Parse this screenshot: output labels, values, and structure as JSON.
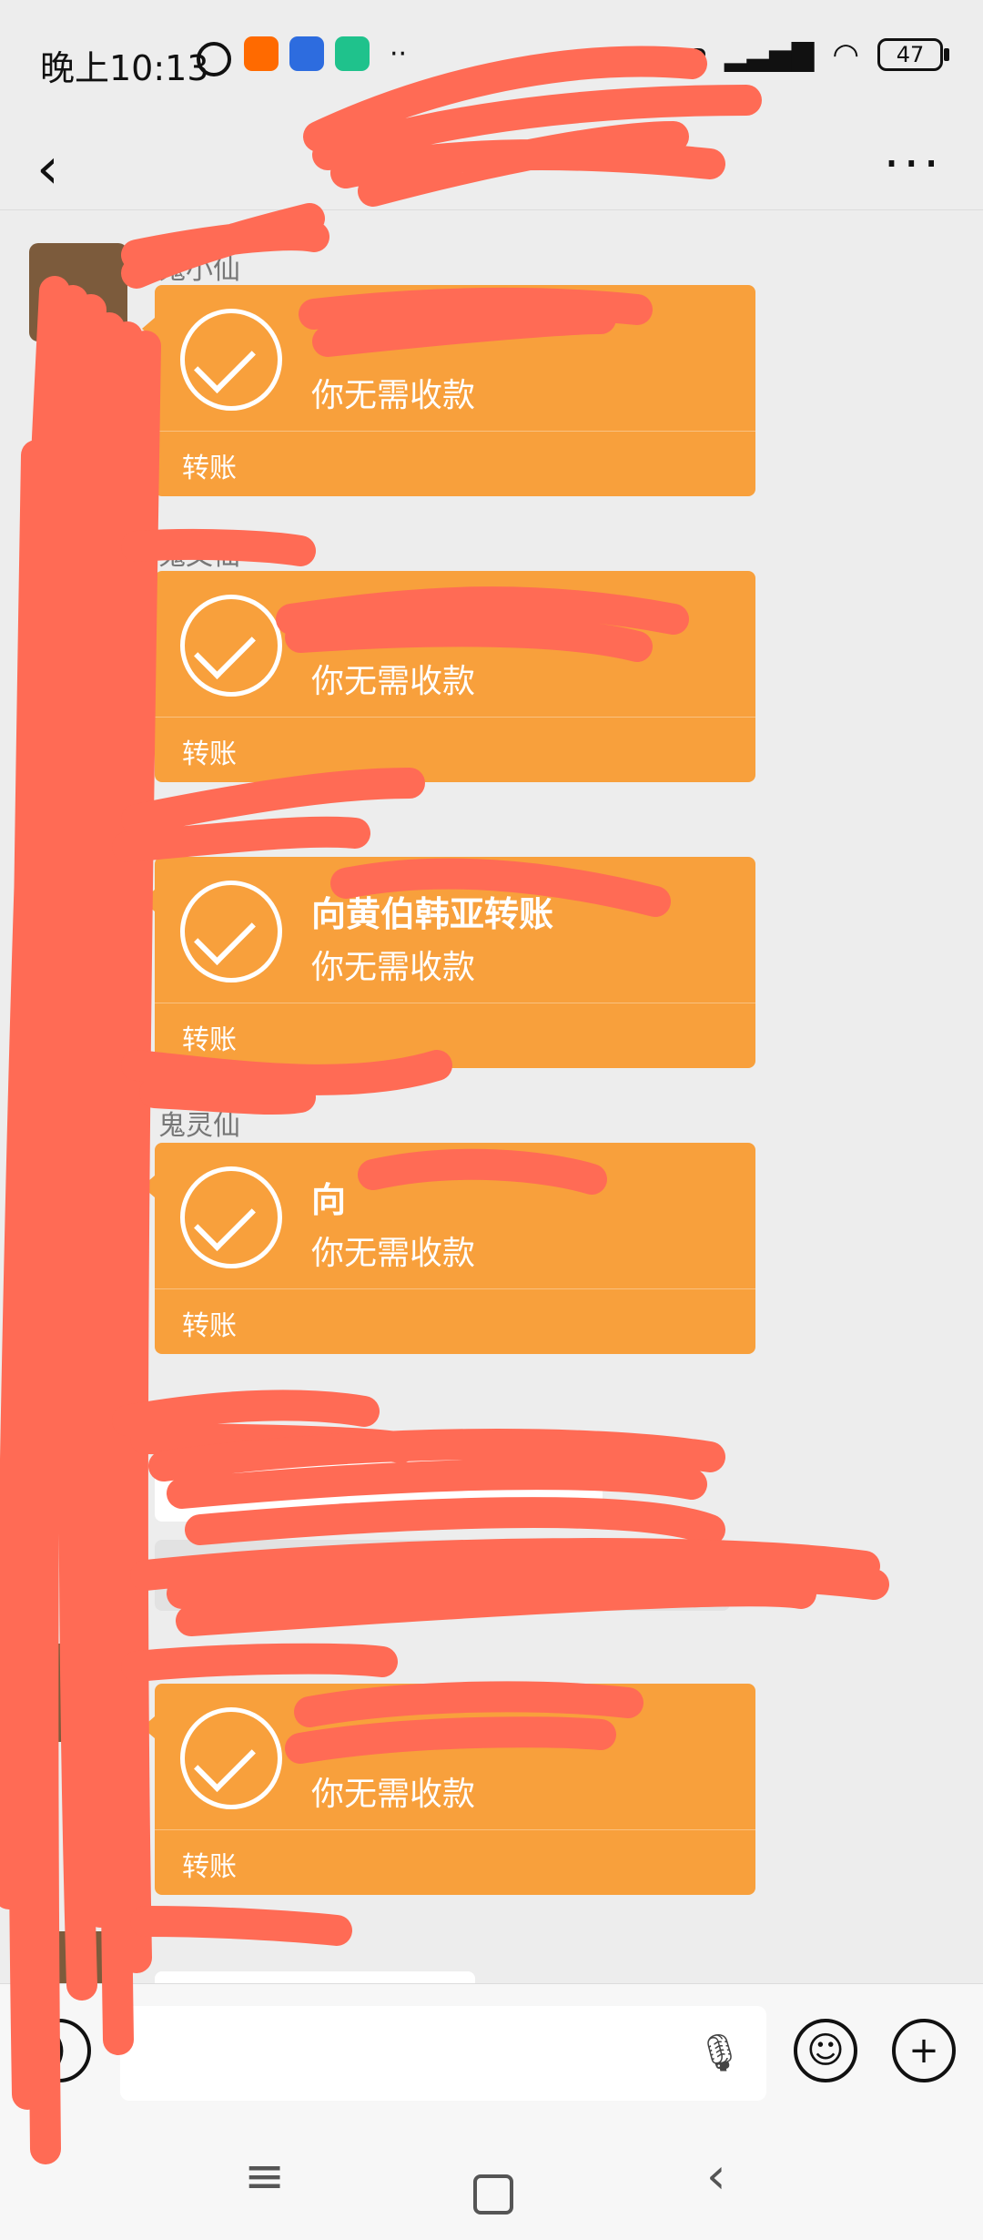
{
  "status_bar": {
    "time": "晚上10:13",
    "alarm_icon": "alarm-icon",
    "network_label": "HD",
    "battery": "47"
  },
  "header": {
    "back_icon": "chevron-left-icon",
    "more_icon": "more-dots-icon"
  },
  "messages": [
    {
      "sender": "鬼小仙",
      "subtitle": "你无需收款",
      "footer": "转账"
    },
    {
      "sender": "鬼文仙",
      "subtitle": "你无需收款",
      "footer": "转账"
    },
    {
      "title": "向黄伯韩亚转账",
      "subtitle": "你无需收款",
      "footer": "转账"
    },
    {
      "sender": "鬼灵仙",
      "title": "向",
      "subtitle": "你无需收款",
      "footer": "转账"
    },
    {
      "subtitle": "你无需收款",
      "footer": "转账"
    }
  ],
  "input_bar": {
    "voice_icon": "voice-toggle-icon",
    "mic_icon": "microphone-icon",
    "emoji_icon": "emoji-icon",
    "plus_icon": "plus-icon"
  },
  "nav_bar": {
    "menu_icon": "menu-icon",
    "home_icon": "home-square-icon",
    "back_icon": "back-triangle-icon"
  },
  "colors": {
    "transfer_card": "#f8a03c",
    "redaction": "#ff6b55",
    "background": "#ededed"
  }
}
